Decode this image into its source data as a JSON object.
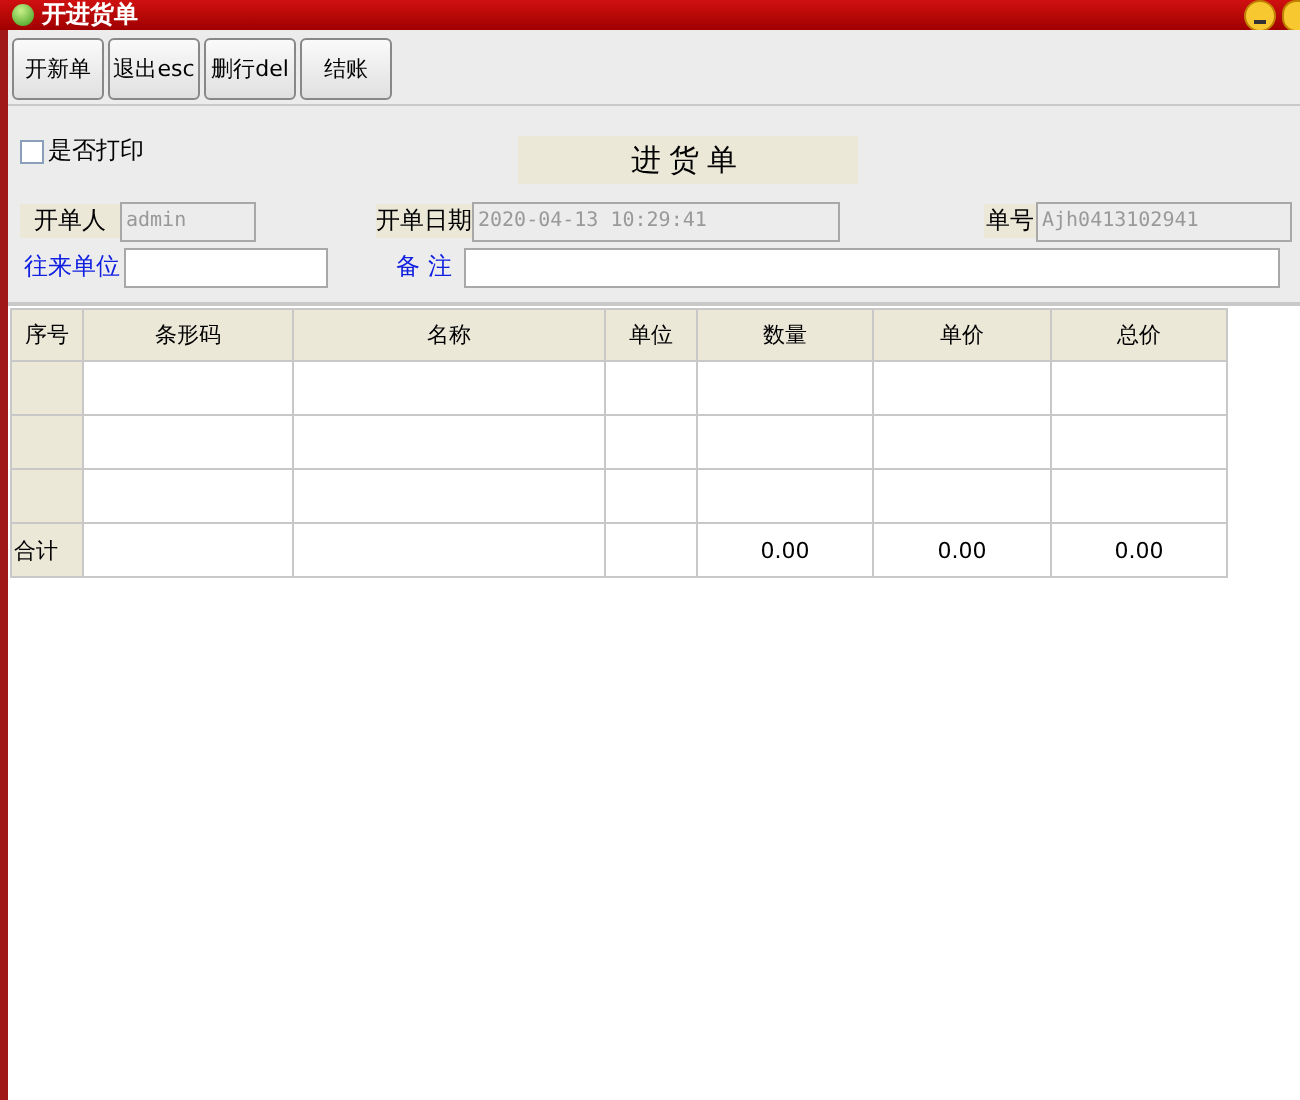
{
  "window": {
    "title": "开进货单"
  },
  "toolbar": [
    "开新单",
    "退出esc",
    "删行del",
    "结账"
  ],
  "print_option": {
    "label": "是否打印",
    "checked": false
  },
  "form_title": "进货单",
  "fields_row_1": [
    {
      "label": "开单人",
      "value": "admin",
      "kind": "readonly"
    },
    {
      "label": "开单日期",
      "value": "2020-04-13 10:29:41",
      "kind": "readonly"
    },
    {
      "label": "单号",
      "value": "Ajh0413102941",
      "kind": "readonly"
    }
  ],
  "fields_row_2": [
    {
      "label": "往来单位",
      "kind": "input"
    },
    {
      "label": "备 注",
      "kind": "input"
    }
  ],
  "table": {
    "columns": [
      "序号",
      "条形码",
      "名称",
      "单位",
      "数量",
      "单价",
      "总价"
    ],
    "rows": [
      {
        "kind": "blank"
      },
      {
        "kind": "blank"
      },
      {
        "kind": "blank"
      }
    ],
    "totals": {
      "label": "合计",
      "quantity": "0.00",
      "unit_price": "0.00",
      "total": "0.00"
    }
  }
}
